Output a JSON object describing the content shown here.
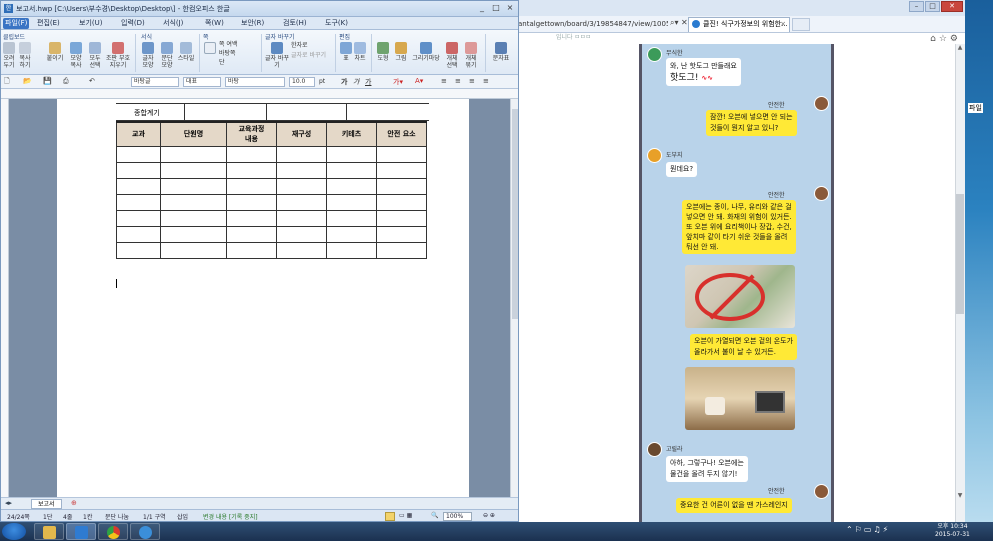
{
  "hwp": {
    "title": "보고서.hwp [C:\\Users\\부수경\\Desktop\\Desktop\\] - 한컴오피스 한글",
    "window_buttons": [
      "_",
      "□",
      "×"
    ],
    "menu": [
      {
        "label": "파일(F)",
        "active": true
      },
      {
        "label": "편집(E)"
      },
      {
        "label": "보기(U)"
      },
      {
        "label": "입력(D)"
      },
      {
        "label": "서식(J)"
      },
      {
        "label": "쪽(W)"
      },
      {
        "label": "보안(R)"
      },
      {
        "label": "검토(H)"
      },
      {
        "label": "도구(K)"
      }
    ],
    "ribbon": {
      "groups": [
        "클립보드",
        "서식",
        "쪽",
        "글자 바꾸기",
        "편집"
      ],
      "buttons": [
        "오려두기",
        "복사하기",
        "붙이기",
        "모양 복사",
        "모두 선택",
        "조판 부호 지우기",
        "글자 모양",
        "문단 모양",
        "스타일",
        "쪽 여백",
        "바탕쪽",
        "단",
        "글자 바꾸기",
        "한자로",
        "글자로 바꾸기",
        "표",
        "차트",
        "도형",
        "그림",
        "그리기마당",
        "개체 선택",
        "개체 묶기",
        "문자표"
      ]
    },
    "format_bar": {
      "style": "바탕글",
      "language": "대표",
      "font": "바탕",
      "size": "10.0",
      "size_unit": "pt",
      "bold": "가",
      "italic": "가",
      "underline": "가"
    },
    "table": {
      "top_row_label": "종합계기",
      "headers": [
        "교과",
        "단원명",
        "교육과정\n내용",
        "재구성",
        "키테츠",
        "안전 요소"
      ],
      "empty_rows": 7
    },
    "sheet_tab": "보고서",
    "status": {
      "page": "24/24쪽",
      "section": "1단",
      "line": "4줄",
      "col": "1칸",
      "mode": "문단 나눔",
      "area": "1/1 구역",
      "insert": "삽입",
      "track": "변경 내용 [기록 중지]",
      "zoom": "100%"
    }
  },
  "browser": {
    "url": "antalgettown/board/3/19854847/view/1005072",
    "tab1_label": "클진! 식구가정보의 위험한...",
    "menu_faint": "입니다 ㅁㅁㅁ"
  },
  "chat": {
    "messages": [
      {
        "sender": "무식한",
        "side": "left",
        "lines": [
          "와, 난 핫도그 만들래요",
          "핫도그! "
        ]
      },
      {
        "sender": "안전한",
        "side": "right",
        "lines": [
          "잠깐! 오븐에 넣으면 안 되는",
          "것들이 뭔지 알고 있니?"
        ]
      },
      {
        "sender": "도부지",
        "side": "left",
        "lines": [
          "뭔데요?"
        ]
      },
      {
        "sender": "안전한",
        "side": "right",
        "lines": [
          "오븐에는 종이, 나무, 유리와 같은 걸",
          "넣으면 안 돼. 화재의 위험이 있거든.",
          "또 오븐 위에 요리책이나 장갑, 수건,",
          "앞치마 같이 타기 쉬운 것들을 올려",
          "둬선 안 돼."
        ]
      },
      {
        "sender": "",
        "side": "right",
        "lines": [
          "오븐이 가열되면 오븐 겉의 온도가",
          "올라가서 불이 날 수 있거든."
        ]
      },
      {
        "sender": "고릴라",
        "side": "left",
        "lines": [
          "아하, 그렇구나! 오븐에는",
          "물건을 올려 두지 않기!"
        ]
      },
      {
        "sender": "안전한",
        "side": "right",
        "lines": [
          "중요한 건 어른이 없을 땐 가스레인지"
        ]
      }
    ]
  },
  "desktop": {
    "side_label": "파일"
  },
  "taskbar": {
    "clock_time": "오후 10:34",
    "clock_date": "2015-07-31"
  }
}
